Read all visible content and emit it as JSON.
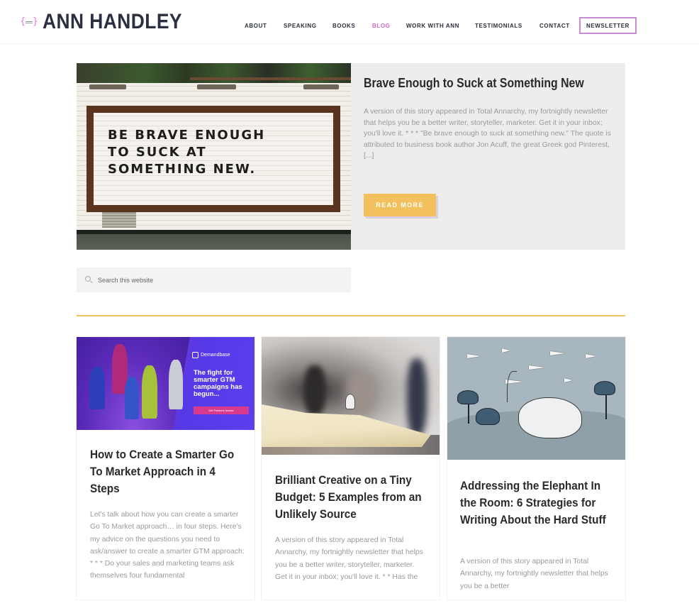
{
  "header": {
    "logo_text": "ANN HANDLEY",
    "logo_icon": "bracketed-glasses-icon",
    "nav": [
      {
        "label": "ABOUT",
        "active": false
      },
      {
        "label": "SPEAKING",
        "active": false
      },
      {
        "label": "BOOKS",
        "active": false
      },
      {
        "label": "BLOG",
        "active": true
      },
      {
        "label": "WORK WITH ANN",
        "active": false
      },
      {
        "label": "TESTIMONIALS",
        "active": false
      },
      {
        "label": "CONTACT",
        "active": false
      }
    ],
    "newsletter_label": "NEWSLETTER"
  },
  "featured": {
    "image_sign_text": "BE BRAVE ENOUGH\nTO SUCK AT\nSOMETHING NEW.",
    "image_sign_lines": [
      "BE BRAVE ENOUGH",
      "TO SUCK AT",
      "SOMETHING NEW."
    ],
    "title": "Brave Enough to Suck at Something New",
    "excerpt": "A version of this story appeared in Total Annarchy, my fortnightly newsletter that helps you be a better writer, storyteller, marketer. Get it in your inbox; you'll love it. * * * \"Be brave enough to suck at something new.\" The quote is attributed to business book author Jon Acuff, the great Greek god Pinterest, [...]",
    "read_more_label": "READ MORE"
  },
  "search": {
    "placeholder": "Search this website",
    "value": ""
  },
  "posts": [
    {
      "title": "How to Create a Smarter Go To Market Approach in 4 Steps",
      "excerpt": "Let's talk about how you can create a smarter Go To Market approach… in four steps. Here's my advice on the questions you need to ask/answer to create a smarter GTM approach: * * * Do your sales and marketing teams ask themselves four fundamental",
      "image": {
        "brand": "Demandbase",
        "tagline": "The fight for smarter GTM campaigns has begun...",
        "cta": "Get Partners Insider"
      }
    },
    {
      "title": "Brilliant Creative on a Tiny Budget: 5 Examples from an Unlikely Source",
      "excerpt": "A version of this story appeared in Total Annarchy, my fortnightly newsletter that helps you be a better writer, storyteller, marketer. Get it in your inbox; you'll love it. * * Has the",
      "image": {
        "description": "paper-girl-on-open-book"
      }
    },
    {
      "title": "Addressing the Elephant In the Room: 6 Strategies for Writing About the Hard Stuff",
      "excerpt": "A version of this story appeared in Total Annarchy, my fortnightly newsletter that helps you be a better",
      "image": {
        "description": "elephant-with-paper-planes"
      }
    }
  ],
  "colors": {
    "accent_gold": "#f2c05c",
    "accent_pink": "#d467c7",
    "text_dark": "#2b2f3f",
    "excerpt_gray": "#9a9a9a"
  }
}
